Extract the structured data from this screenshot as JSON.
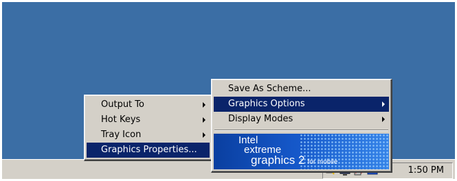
{
  "taskbar": {
    "clock": "1:50 PM",
    "tray_icons": [
      "network-icon",
      "display-icon",
      "disconnected-icon",
      "graphics-tray-icon"
    ]
  },
  "menu_main": {
    "items": [
      {
        "label": "Output To",
        "submenu": true
      },
      {
        "label": "Hot Keys",
        "submenu": true
      },
      {
        "label": "Tray Icon",
        "submenu": true
      },
      {
        "label": "Graphics Properties...",
        "submenu": false,
        "highlighted": true
      }
    ]
  },
  "menu_sub": {
    "items": [
      {
        "label": "Save As Scheme...",
        "submenu": false
      },
      {
        "label": "Graphics Options",
        "submenu": true,
        "highlighted": true
      },
      {
        "label": "Display Modes",
        "submenu": true
      }
    ],
    "banner": {
      "line1": "Intel",
      "line2": "extreme",
      "line3": "graphics 2",
      "line4": "for mobile"
    }
  },
  "colors": {
    "desktop": "#3b6ea5",
    "menu_face": "#d4d0c8",
    "highlight": "#0a246a"
  }
}
